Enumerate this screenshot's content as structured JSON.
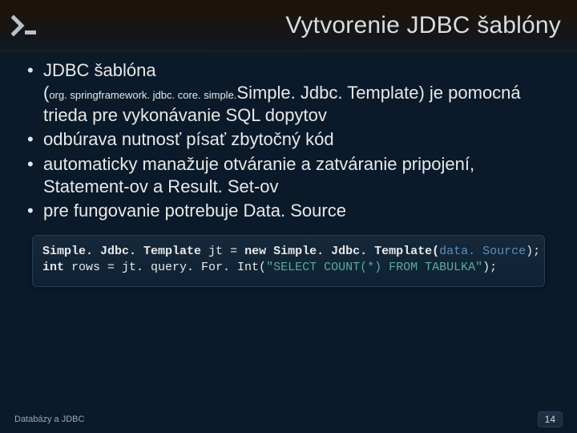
{
  "header": {
    "title": "Vytvorenie JDBC šablóny"
  },
  "bullets": {
    "b1_a": "JDBC šablóna",
    "b1_pkg": "org. springframework. jdbc. core. simple.",
    "b1_cls": "Simple. Jdbc. Template",
    "b1_b": ") je pomocná trieda pre vykonávanie SQL dopytov",
    "b2": "odbúrava nutnosť písať zbytočný kód",
    "b3": "automaticky manažuje otváranie a zatváranie pripojení, Statement-ov a Result. Set-ov",
    "b4_a": "pre fungovanie potrebuje ",
    "b4_ds": "Data. Source"
  },
  "code": {
    "t_type1": "Simple. Jdbc. Template",
    "t_var1": " jt ",
    "t_eq": "= ",
    "t_new": "new",
    "t_type2": " Simple. Jdbc. Template(",
    "t_arg": "data. Source",
    "t_close1": ");",
    "t_int": "int",
    "t_var2": " rows ",
    "t_eq2": "= jt. query. For. Int(",
    "t_str": "\"SELECT COUNT(*) FROM TABULKA\"",
    "t_close2": ");"
  },
  "footer": {
    "left": "Databázy a JDBC",
    "page": "14"
  }
}
